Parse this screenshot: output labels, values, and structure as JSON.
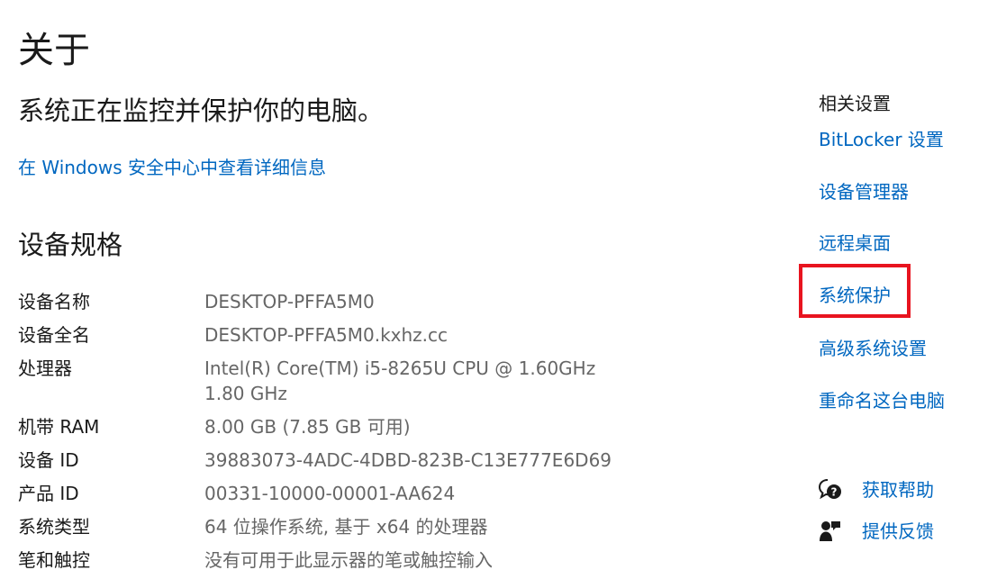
{
  "page": {
    "title": "关于",
    "status": "系统正在监控并保护你的电脑。",
    "security_link": "在 Windows 安全中心中查看详细信息"
  },
  "specs": {
    "heading": "设备规格",
    "rows": [
      {
        "label": "设备名称",
        "value": "DESKTOP-PFFA5M0"
      },
      {
        "label": "设备全名",
        "value": "DESKTOP-PFFA5M0.kxhz.cc"
      },
      {
        "label": "处理器",
        "value": "Intel(R) Core(TM) i5-8265U CPU @ 1.60GHz   1.80 GHz"
      },
      {
        "label": "机带 RAM",
        "value": "8.00 GB (7.85 GB 可用)"
      },
      {
        "label": "设备 ID",
        "value": "39883073-4ADC-4DBD-823B-C13E777E6D69"
      },
      {
        "label": "产品 ID",
        "value": "00331-10000-00001-AA624"
      },
      {
        "label": "系统类型",
        "value": "64 位操作系统, 基于 x64 的处理器"
      },
      {
        "label": "笔和触控",
        "value": "没有可用于此显示器的笔或触控输入"
      }
    ]
  },
  "related": {
    "heading": "相关设置",
    "links": [
      "BitLocker 设置",
      "设备管理器",
      "远程桌面",
      "系统保护",
      "高级系统设置",
      "重命名这台电脑"
    ]
  },
  "help": {
    "get_help": "获取帮助",
    "feedback": "提供反馈",
    "get_help_icon": "chat-help-icon",
    "feedback_icon": "feedback-person-icon"
  },
  "colors": {
    "link": "#0067c0",
    "highlight": "#e8141f",
    "secondary_text": "#666666"
  }
}
